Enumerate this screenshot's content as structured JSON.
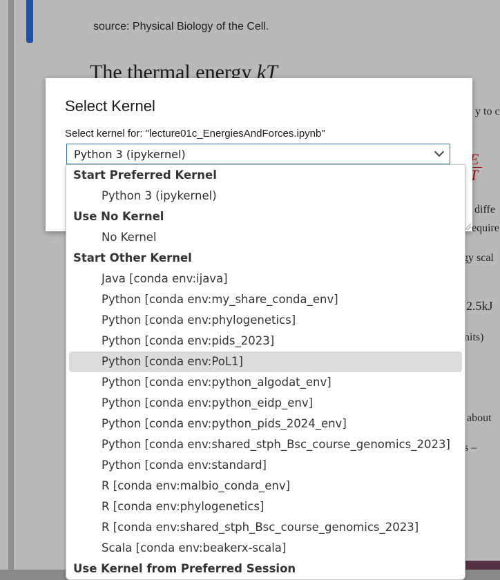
{
  "background": {
    "source_text": "source: Physical Biology of the Cell.",
    "heading_text": "The thermal energy ",
    "heading_math": "kT",
    "fragments": [
      "y to c",
      "y diffe",
      "equire",
      "gy scal",
      "2.5kJ",
      "nits)",
      "about",
      "s  –"
    ],
    "fraction_top": "E",
    "fraction_bottom": "T"
  },
  "dialog": {
    "title": "Select Kernel",
    "subtitle": "Select kernel for: \"lecture01c_EnergiesAndForces.ipynb\""
  },
  "select": {
    "value": "Python 3 (ipykernel)"
  },
  "dropdown": {
    "groups": [
      {
        "label": "Start Preferred Kernel",
        "options": [
          "Python 3 (ipykernel)"
        ]
      },
      {
        "label": "Use No Kernel",
        "options": [
          "No Kernel"
        ]
      },
      {
        "label": "Start Other Kernel",
        "options": [
          "Java [conda env:ijava]",
          "Python [conda env:my_share_conda_env]",
          "Python [conda env:phylogenetics]",
          "Python [conda env:pids_2023]",
          "Python [conda env:PoL1]",
          "Python [conda env:python_algodat_env]",
          "Python [conda env:python_eidp_env]",
          "Python [conda env:python_pids_2024_env]",
          "Python [conda env:shared_stph_Bsc_course_genomics_2023]",
          "Python [conda env:standard]",
          "R [conda env:malbio_conda_env]",
          "R [conda env:phylogenetics]",
          "R [conda env:shared_stph_Bsc_course_genomics_2023]",
          "Scala [conda env:beakerx-scala]"
        ]
      },
      {
        "label": "Use Kernel from Preferred Session",
        "options": []
      }
    ],
    "highlighted": "Python [conda env:PoL1]"
  }
}
